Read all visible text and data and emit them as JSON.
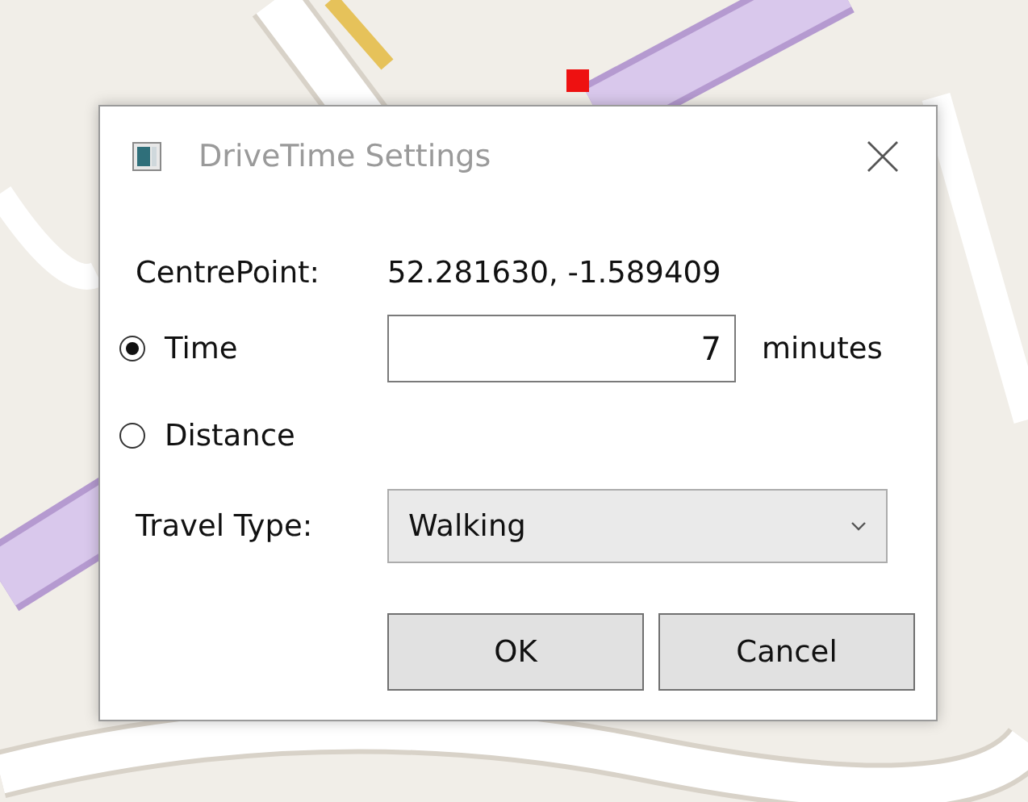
{
  "window": {
    "title": "DriveTime Settings"
  },
  "centre_point": {
    "label": "CentrePoint:",
    "value": "52.281630, -1.589409"
  },
  "mode_options": [
    {
      "label": "Time",
      "selected": true
    },
    {
      "label": "Distance",
      "selected": false
    }
  ],
  "time_field": {
    "value": "7",
    "unit": "minutes"
  },
  "travel_type": {
    "label": "Travel Type:",
    "value": "Walking"
  },
  "buttons": [
    "OK",
    "Cancel"
  ]
}
